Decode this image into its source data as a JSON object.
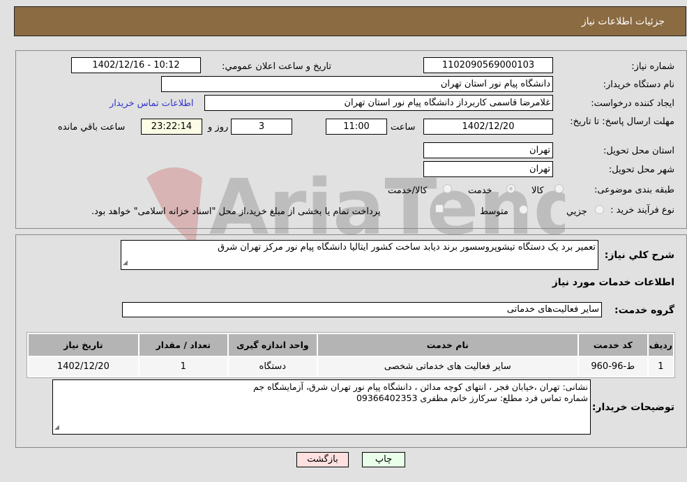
{
  "header": {
    "title": "جزئیات اطلاعات نیاز"
  },
  "form": {
    "need_number_label": "شماره نیاز:",
    "need_number": "1102090569000103",
    "announce_label": "تاریخ و ساعت اعلان عمومي:",
    "announce_value": "1402/12/16 - 10:12",
    "buyer_org_label": "نام دستگاه خریدار:",
    "buyer_org": "دانشگاه پیام نور استان تهران",
    "creator_label": "ایجاد کننده درخواست:",
    "creator": "غلامرضا قاسمی کاربرداز دانشگاه پیام نور استان تهران",
    "contact_link": "اطلاعات تماس خریدار",
    "deadline_label": "مهلت ارسال پاسخ: تا تاریخ:",
    "deadline_date": "1402/12/20",
    "time_label": "ساعت",
    "deadline_time": "11:00",
    "days": "3",
    "days_label": "روز و",
    "remaining": "23:22:14",
    "remaining_label": "ساعت باقي مانده",
    "province_label": "استان محل تحویل:",
    "province": "تهران",
    "city_label": "شهر محل تحویل:",
    "city": "تهران",
    "category_label": "طبقه بندی موضوعی:",
    "category_options": [
      "کالا",
      "خدمت",
      "کالا/خدمت"
    ],
    "category_selected": "خدمت",
    "process_label": "نوع فرآیند خرید :",
    "process_options": [
      "جزيي",
      "متوسط"
    ],
    "treasury_note": "پرداخت تمام یا بخشی از مبلغ خرید،از محل \"اسناد خزانه اسلامی\" خواهد بود."
  },
  "details": {
    "description_label": "شرح کلي نياز:",
    "description": "تعمیر برد یک دستگاه تیشوپروسسور برند دیابد ساخت کشور ایتالیا دانشگاه پیام نور مرکز تهران شرق",
    "services_heading": "اطلاعات خدمات مورد نیاز",
    "service_group_label": "گروه خدمت:",
    "service_group": "سایر فعالیت‌های خدماتی",
    "table": {
      "headers": [
        "ردیف",
        "کد خدمت",
        "نام خدمت",
        "واحد اندازه گیری",
        "تعداد / مقدار",
        "تاریخ نیاز"
      ],
      "rows": [
        [
          "1",
          "ط-96-960",
          "سایر فعالیت های خدماتی شخصی",
          "دستگاه",
          "1",
          "1402/12/20"
        ]
      ]
    },
    "buyer_notes_label": "توضیحات خریدار:",
    "buyer_notes_line1": "نشانی: تهران  ،خیابان فجر ، انتهای کوچه مدائن ، دانشگاه پیام نور تهران شرق، آزمایشگاه جم",
    "buyer_notes_line2": "شماره تماس فرد مطلع: سرکارز خانم مظفری 09366402353"
  },
  "buttons": {
    "print": "چاپ",
    "back": "بازگشت"
  },
  "colors": {
    "header": "#8b6b42",
    "print_bg": "#eaffea",
    "back_bg": "#ffe0e0",
    "link": "#3333cc"
  }
}
